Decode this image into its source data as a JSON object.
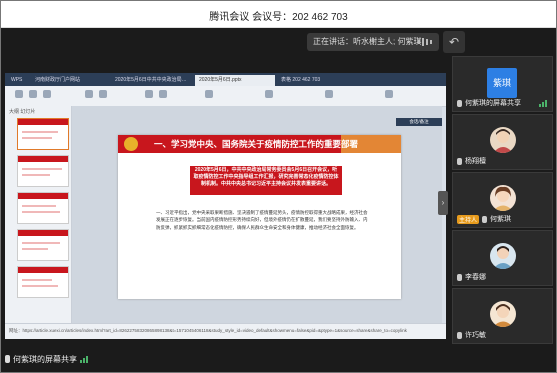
{
  "window": {
    "title": "腾讯会议  会议号：202 462 703"
  },
  "speaking": {
    "label": "正在讲话：听水榭主人; 何紫琪"
  },
  "share": {
    "tabs": [
      "WPS",
      "河南财政厅门户网站",
      "2020年5月6日中共中央政治局…",
      "2020年5月6日.pptx",
      "表格 202 462 703"
    ],
    "active_tab": 3,
    "thumbs_header": "大纲  幻灯片",
    "notes_tab": "会话/备注",
    "slide": {
      "banner_title": "一、学习党中央、国务院关于疫情防控工作的重要部署",
      "red_box": "2020年5月6日，中共中央政治局常务委员会5月6日召开会议，听取疫情防控工作中央指导组工作汇报，研究完善常态化疫情防控体制机制。中共中央总书记习近平主持会议并发表重要讲话。",
      "body": "一、习近平指出，党中央采取果断措施、坚决遏制了疫情蔓延势头，疫情防控取得重大战略成果，经济社会发展正在逐步恢复。当前国内疫情防控形势持续向好，但境外疫情仍在扩散蔓延，我们要坚持外防输入、内防反弹，抓紧抓实抓细常态化疫情防控，确保人民群众生命安全和身体健康，推动经济社会全面恢复。"
    },
    "url": "网址：https://article.xuexi.cn/articles/index.html?art_id=82622758320865898138&t=1571045406118&study_style_id=video_default&showmenu=false&pid=&ptype=1&source=share&share_to=copylink"
  },
  "participants": [
    {
      "name": "何紫琪的屏幕共享",
      "avatar_text": "紫琪",
      "kind": "text",
      "host": false
    },
    {
      "name": "杨翔檀",
      "kind": "photo",
      "host": false
    },
    {
      "name": "何紫琪",
      "kind": "photo",
      "host": true,
      "host_label": "主持人"
    },
    {
      "name": "李春娜",
      "kind": "photo",
      "host": false
    },
    {
      "name": "许巧敏",
      "kind": "photo",
      "host": false
    }
  ],
  "bottom": {
    "label": "何紫琪的屏幕共享"
  }
}
